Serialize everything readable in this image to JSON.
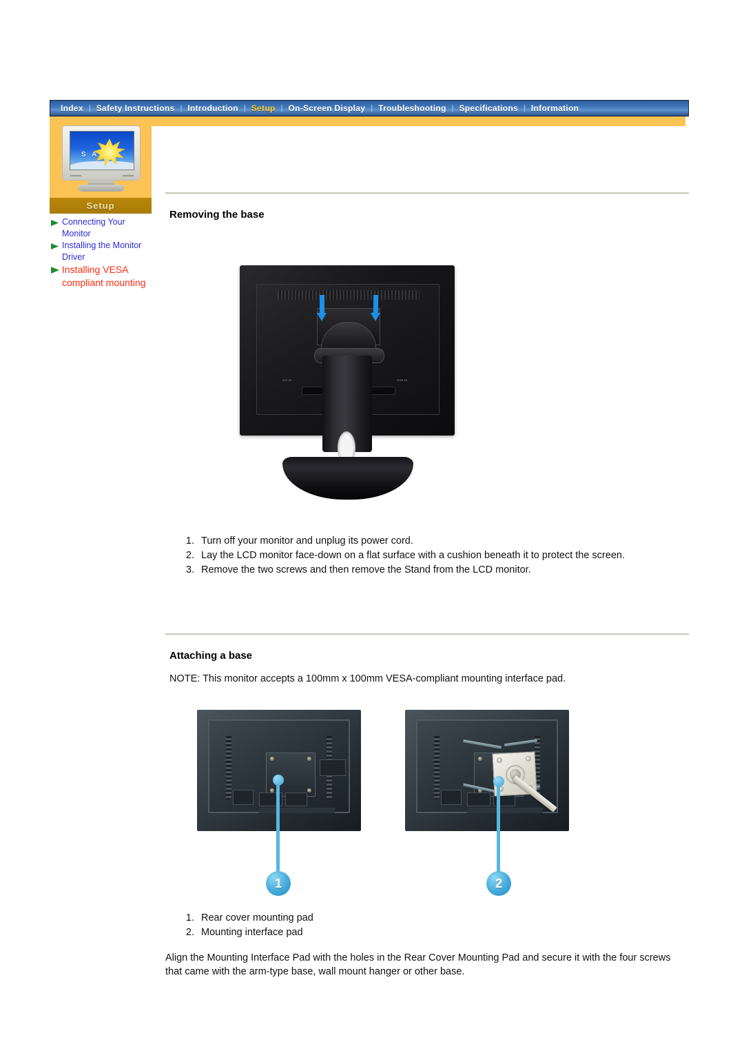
{
  "nav": {
    "separator": "|",
    "items": [
      {
        "label": "Index",
        "active": false
      },
      {
        "label": "Safety Instructions",
        "active": false
      },
      {
        "label": "Introduction",
        "active": false
      },
      {
        "label": "Setup",
        "active": true
      },
      {
        "label": "On-Screen Display",
        "active": false
      },
      {
        "label": "Troubleshooting",
        "active": false
      },
      {
        "label": "Specifications",
        "active": false
      },
      {
        "label": "Information",
        "active": false
      }
    ]
  },
  "sidebar": {
    "logo_brand": "S A M S",
    "tab_label": "Setup",
    "links": [
      {
        "label": "Connecting Your Monitor",
        "current": false
      },
      {
        "label": "Installing the Monitor Driver",
        "current": false
      },
      {
        "label": "Installing VESA compliant mounting",
        "current": true
      }
    ]
  },
  "colors": {
    "nav_background": "#3d74b8",
    "nav_active_text": "#ffcc22",
    "band_orange": "#fbc354",
    "tab_gold": "#b8860a",
    "link_blue": "#2b2bd6",
    "link_current_red": "#ff2a10",
    "arrow_green": "#1f8a2e",
    "callout_blue": "#45aadc",
    "figure_arrow_blue": "#1e8fe8"
  },
  "sections": [
    {
      "id": "removing",
      "title": "Removing the base",
      "steps": [
        {
          "num": "1.",
          "text": "Turn off your monitor and unplug its power cord."
        },
        {
          "num": "2.",
          "text": "Lay the LCD monitor face-down on a flat surface with a cushion beneath it to protect the screen."
        },
        {
          "num": "3.",
          "text": "Remove the two screws and then remove the Stand from the LCD monitor."
        }
      ]
    },
    {
      "id": "attaching",
      "title": "Attaching a base",
      "note": "NOTE: This monitor accepts a 100mm x 100mm VESA-compliant mounting interface pad.",
      "steps": [
        {
          "num": "1.",
          "text": "Rear cover mounting pad"
        },
        {
          "num": "2.",
          "text": "Mounting interface pad"
        }
      ],
      "paragraph": "Align the Mounting Interface Pad with the holes in the Rear Cover Mounting Pad and secure it with the four screws that came with the arm-type base, wall mount hanger or other base."
    }
  ],
  "figures": {
    "removing_base": {
      "port_label_left": "DVI IN",
      "port_label_right": "RGB IN"
    },
    "attaching": {
      "callout_1": "1",
      "callout_2": "2"
    }
  }
}
